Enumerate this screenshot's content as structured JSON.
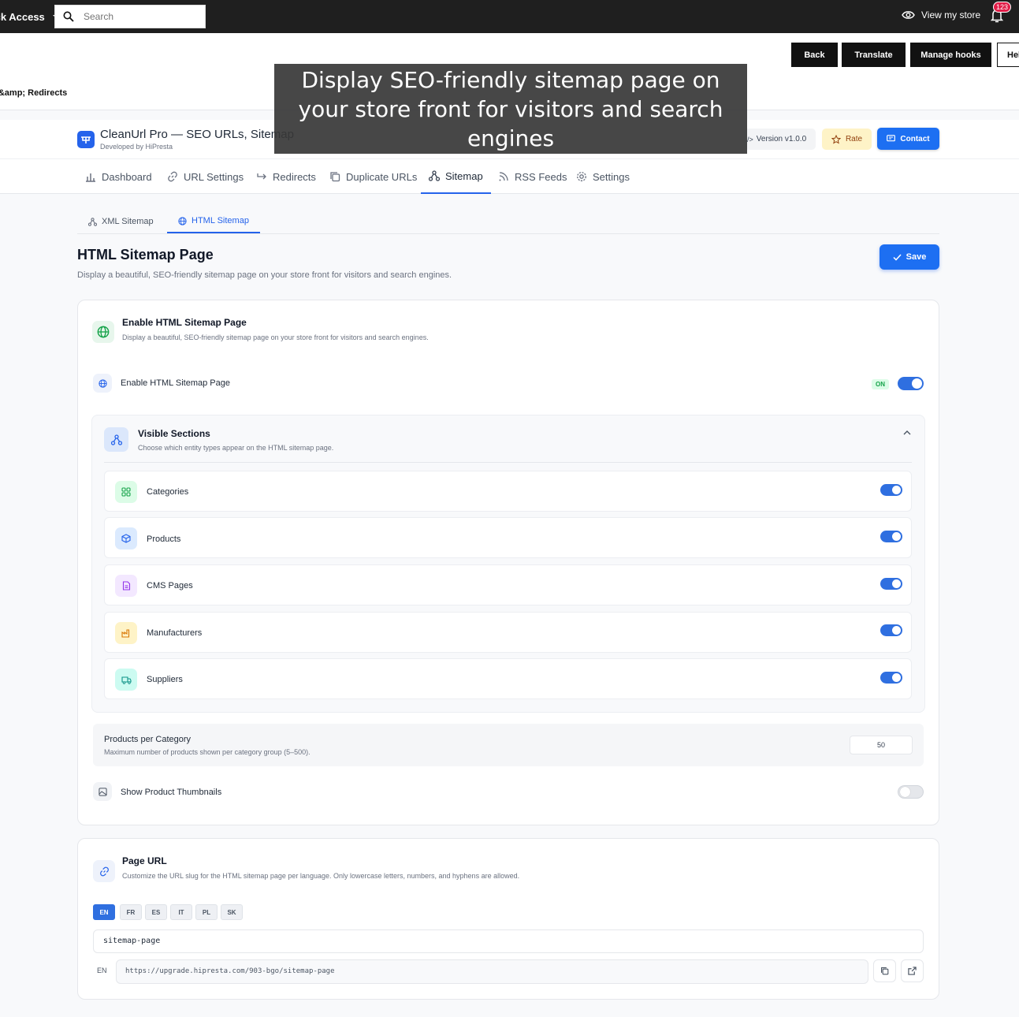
{
  "topbar": {
    "quick_access": "Quick Access",
    "search_placeholder": "Search",
    "view_store": "View my store",
    "notifications": "123"
  },
  "header": {
    "breadcrumb": "Sitemap &amp; Redirects",
    "buttons": {
      "back": "Back",
      "translate": "Translate",
      "manage_hooks": "Manage hooks",
      "help": "Help"
    }
  },
  "caption": "Display SEO-friendly sitemap page on your store front for visitors and search engines",
  "module": {
    "title": "CleanUrl Pro — SEO URLs, Sitemap",
    "subtitle": "Developed by HiPresta",
    "version": "Version v1.0.0",
    "rate": "Rate",
    "contact": "Contact"
  },
  "tabs": [
    "Dashboard",
    "URL Settings",
    "Redirects",
    "Duplicate URLs",
    "Sitemap",
    "RSS Feeds",
    "Settings"
  ],
  "subtabs": [
    "XML Sitemap",
    "HTML Sitemap"
  ],
  "page": {
    "title": "HTML Sitemap Page",
    "description": "Display a beautiful, SEO-friendly sitemap page on your store front for visitors and search engines.",
    "save": "Save"
  },
  "enable_card": {
    "title": "Enable HTML Sitemap Page",
    "description": "Display a beautiful, SEO-friendly sitemap page on your store front for visitors and search engines.",
    "row_label": "Enable HTML Sitemap Page",
    "status": "ON",
    "enabled": true
  },
  "visible_sections": {
    "title": "Visible Sections",
    "description": "Choose which entity types appear on the HTML sitemap page.",
    "items": [
      {
        "label": "Categories",
        "enabled": true
      },
      {
        "label": "Products",
        "enabled": true
      },
      {
        "label": "CMS Pages",
        "enabled": true
      },
      {
        "label": "Manufacturers",
        "enabled": true
      },
      {
        "label": "Suppliers",
        "enabled": true
      }
    ]
  },
  "products_per_category": {
    "title": "Products per Category",
    "description": "Maximum number of products shown per category group (5–500).",
    "value": "50"
  },
  "thumbnails": {
    "label": "Show Product Thumbnails",
    "enabled": false
  },
  "page_url": {
    "title": "Page URL",
    "description": "Customize the URL slug for the HTML sitemap page per language. Only lowercase letters, numbers, and hyphens are allowed.",
    "languages": [
      "EN",
      "FR",
      "ES",
      "IT",
      "PL",
      "SK"
    ],
    "active_language": "EN",
    "slug": "sitemap-page",
    "preview_lang": "EN",
    "preview_url": "https://upgrade.hipresta.com/903-bgo/sitemap-page"
  },
  "colors": {
    "accent": "#1d6ff2",
    "topbar": "#1f1f1f"
  }
}
